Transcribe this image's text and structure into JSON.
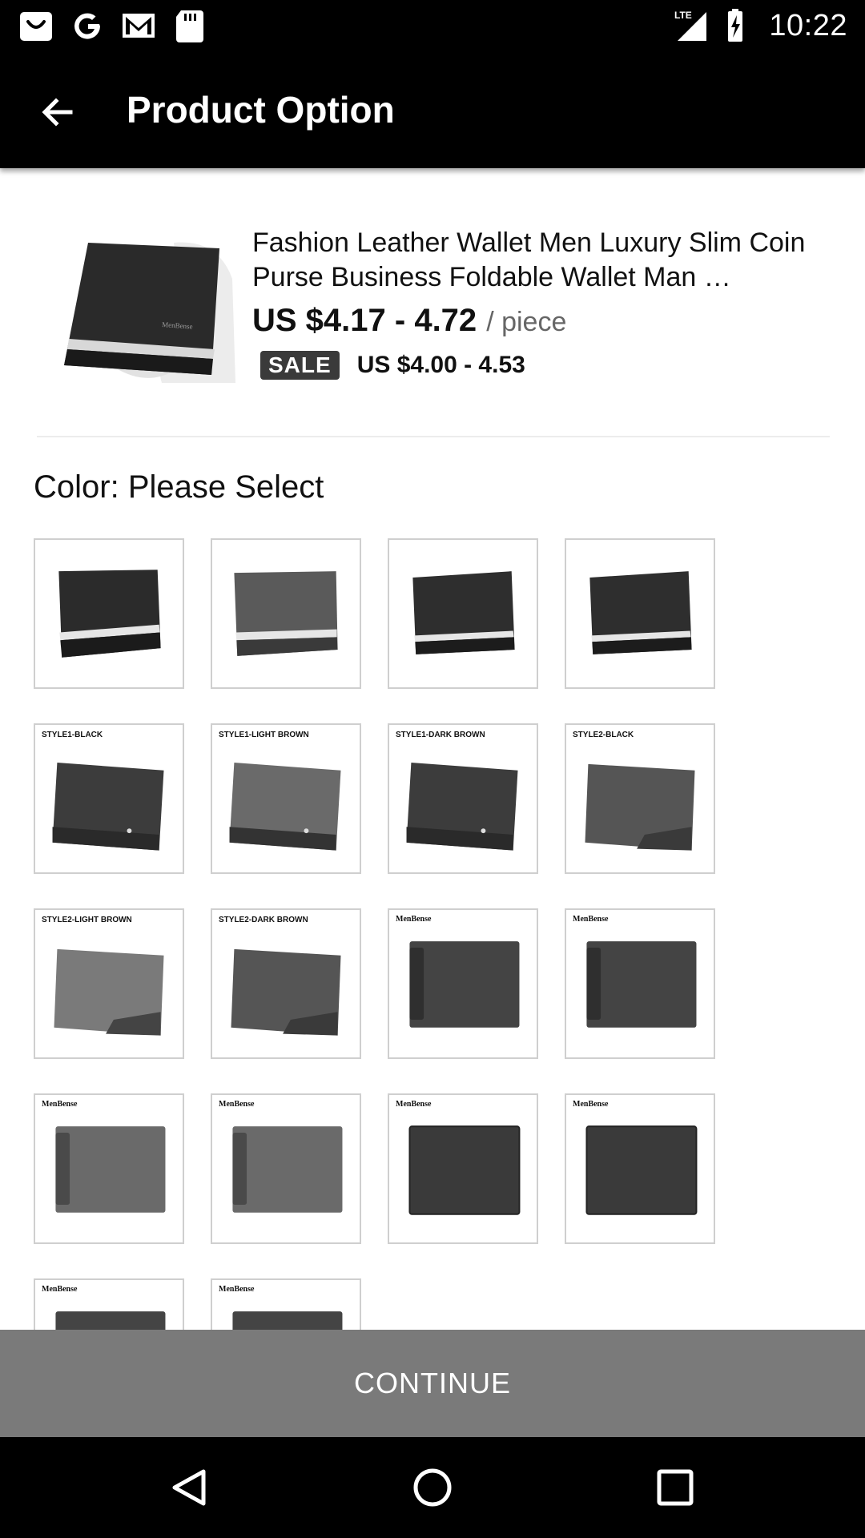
{
  "status_bar": {
    "time": "10:22",
    "network": "LTE",
    "left_icons": [
      "shopping-bag-icon",
      "google-icon",
      "gmail-icon",
      "sd-card-icon"
    ],
    "right_icons": [
      "signal-icon",
      "battery-charging-icon"
    ]
  },
  "app_bar": {
    "title": "Product Option",
    "back_icon": "arrow-back-icon"
  },
  "product": {
    "title": "Fashion Leather Wallet Men Luxury Slim Coin Purse Business Foldable Wallet Man …",
    "price": "US $4.17 - 4.72",
    "unit": "/ piece",
    "sale_badge": "SALE",
    "sale_price": "US $4.00 - 4.53"
  },
  "color_section": {
    "label": "Color: Please Select",
    "swatches": [
      {
        "caption": "",
        "brand": "",
        "style": "stripe-speckle"
      },
      {
        "caption": "",
        "brand": "",
        "style": "stripe-suede"
      },
      {
        "caption": "",
        "brand": "",
        "style": "stripe-dark"
      },
      {
        "caption": "",
        "brand": "",
        "style": "stripe-dark"
      },
      {
        "caption": "STYLE1-BLACK",
        "brand": "",
        "style": "style1"
      },
      {
        "caption": "STYLE1-LIGHT BROWN",
        "brand": "",
        "style": "style1-light"
      },
      {
        "caption": "STYLE1-DARK BROWN",
        "brand": "",
        "style": "style1"
      },
      {
        "caption": "STYLE2-BLACK",
        "brand": "",
        "style": "style2"
      },
      {
        "caption": "STYLE2-LIGHT BROWN",
        "brand": "",
        "style": "style2-light"
      },
      {
        "caption": "STYLE2-DARK BROWN",
        "brand": "",
        "style": "style2"
      },
      {
        "caption": "",
        "brand": "MenBense",
        "style": "open"
      },
      {
        "caption": "",
        "brand": "MenBense",
        "style": "open"
      },
      {
        "caption": "",
        "brand": "MenBense",
        "style": "open-light"
      },
      {
        "caption": "",
        "brand": "MenBense",
        "style": "open-light"
      },
      {
        "caption": "",
        "brand": "MenBense",
        "style": "closed"
      },
      {
        "caption": "",
        "brand": "MenBense",
        "style": "closed"
      },
      {
        "caption": "",
        "brand": "MenBense",
        "style": "partial"
      },
      {
        "caption": "",
        "brand": "MenBense",
        "style": "partial"
      }
    ]
  },
  "continue_button": {
    "label": "CONTINUE"
  },
  "nav_bar": {
    "icons": [
      "nav-back-icon",
      "nav-home-icon",
      "nav-recents-icon"
    ]
  },
  "colors": {
    "bars": "#000000",
    "continue_bg": "#7a7a7a",
    "sale_badge_bg": "#3a3a3a",
    "swatch_border": "#cfcfcf"
  }
}
